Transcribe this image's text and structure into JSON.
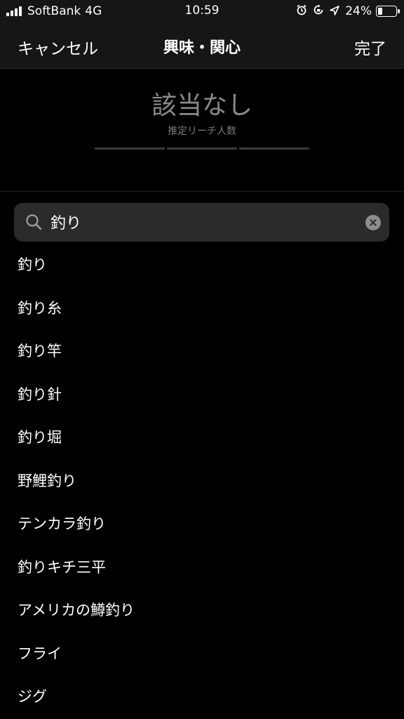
{
  "status_bar": {
    "carrier": "SoftBank",
    "network": "4G",
    "time": "10:59",
    "battery_percent_label": "24%",
    "battery_level": 0.24,
    "icons": [
      "signal-icon",
      "alarm-icon",
      "orientation-lock-icon",
      "location-icon",
      "battery-icon"
    ]
  },
  "nav": {
    "cancel_label": "キャンセル",
    "title": "興味・関心",
    "done_label": "完了"
  },
  "reach": {
    "value": "該当なし",
    "label": "推定リーチ人数"
  },
  "search": {
    "value": "釣り",
    "icon": "search-icon",
    "clear_icon": "clear-icon"
  },
  "results": [
    "釣り",
    "釣り糸",
    "釣り竿",
    "釣り針",
    "釣り堀",
    "野鯉釣り",
    "テンカラ釣り",
    "釣りキチ三平",
    "アメリカの鱒釣り",
    "フライ",
    "ジグ"
  ],
  "colors": {
    "background": "#000000",
    "bar_background": "#161616",
    "search_background": "#2b2b2b",
    "muted_text": "#8a8a8a"
  }
}
